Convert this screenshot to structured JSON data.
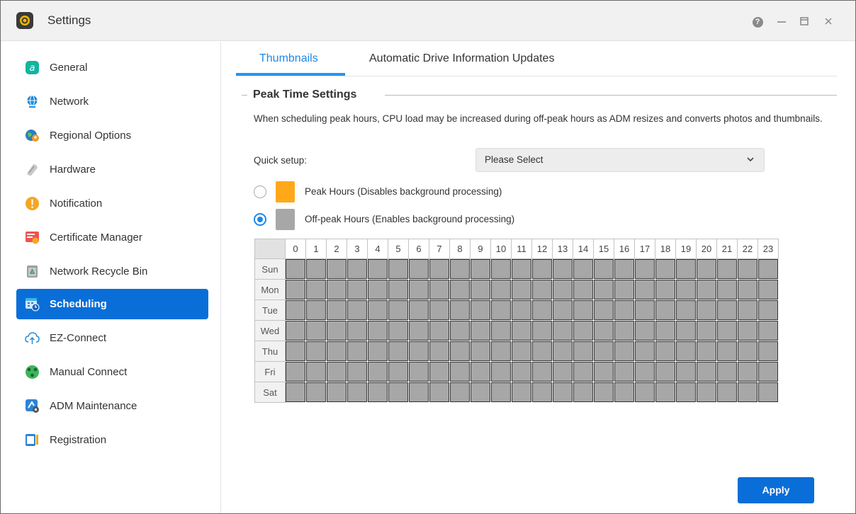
{
  "window": {
    "title": "Settings"
  },
  "sidebar": {
    "items": [
      {
        "label": "General",
        "icon": "general-icon",
        "active": false
      },
      {
        "label": "Network",
        "icon": "globe-icon",
        "active": false
      },
      {
        "label": "Regional Options",
        "icon": "regional-icon",
        "active": false
      },
      {
        "label": "Hardware",
        "icon": "hardware-icon",
        "active": false
      },
      {
        "label": "Notification",
        "icon": "exclamation-icon",
        "active": false
      },
      {
        "label": "Certificate Manager",
        "icon": "certificate-icon",
        "active": false
      },
      {
        "label": "Network Recycle Bin",
        "icon": "recycle-bin-icon",
        "active": false
      },
      {
        "label": "Scheduling",
        "icon": "calendar-clock-icon",
        "active": true
      },
      {
        "label": "EZ-Connect",
        "icon": "cloud-upload-icon",
        "active": false
      },
      {
        "label": "Manual Connect",
        "icon": "manual-connect-icon",
        "active": false
      },
      {
        "label": "ADM Maintenance",
        "icon": "maintenance-icon",
        "active": false
      },
      {
        "label": "Registration",
        "icon": "registration-icon",
        "active": false
      }
    ]
  },
  "tabs": [
    {
      "label": "Thumbnails",
      "active": true
    },
    {
      "label": "Automatic Drive Information Updates",
      "active": false
    }
  ],
  "section": {
    "title": "Peak Time Settings",
    "description": "When scheduling peak hours, CPU load may be increased during off-peak hours as ADM resizes and converts photos and thumbnails."
  },
  "quick_setup": {
    "label": "Quick setup:",
    "value": "Please Select"
  },
  "legend": {
    "peak": {
      "label": "Peak Hours (Disables background processing)",
      "color": "#ffa91a",
      "selected": false
    },
    "offpeak": {
      "label": "Off-peak Hours (Enables background processing)",
      "color": "#a7a7a7",
      "selected": true
    }
  },
  "schedule": {
    "hours": [
      "0",
      "1",
      "2",
      "3",
      "4",
      "5",
      "6",
      "7",
      "8",
      "9",
      "10",
      "11",
      "12",
      "13",
      "14",
      "15",
      "16",
      "17",
      "18",
      "19",
      "20",
      "21",
      "22",
      "23"
    ],
    "days": [
      "Sun",
      "Mon",
      "Tue",
      "Wed",
      "Thu",
      "Fri",
      "Sat"
    ],
    "all_cells": "off-peak"
  },
  "buttons": {
    "apply": "Apply"
  },
  "colors": {
    "accent": "#0a6ed8",
    "tab_active": "#1e88e5"
  }
}
